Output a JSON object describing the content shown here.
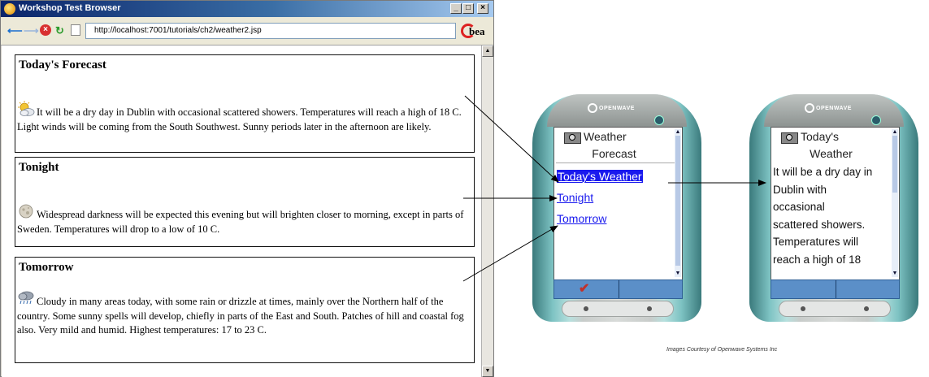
{
  "window": {
    "title": "Workshop Test Browser",
    "controls": {
      "minimize": "_",
      "maximize": "□",
      "close": "×"
    }
  },
  "toolbar": {
    "url": "http://localhost:7001/tutorials/ch2/weather2.jsp",
    "logo_text": "bea",
    "icons": [
      "back-arrow-icon",
      "forward-arrow-icon",
      "stop-icon",
      "refresh-icon",
      "page-icon"
    ]
  },
  "sections": [
    {
      "title": "Today's Forecast",
      "icon": "sun-cloud-icon",
      "text": "It will be a dry day in Dublin with occasional scattered showers. Temperatures will reach a high of 18 C. Light winds will be coming from the South Southwest. Sunny periods later in the afternoon are likely."
    },
    {
      "title": "Tonight",
      "icon": "moon-icon",
      "text": "Widespread darkness will be expected this evening but will brighten closer to morning, except in parts of Sweden. Temperatures will drop to a low of 10 C."
    },
    {
      "title": "Tomorrow",
      "icon": "rain-cloud-icon",
      "text": "Cloudy in many areas today, with some rain or drizzle at times, mainly over the Northern half of the country. Some sunny spells will develop, chiefly in parts of the East and South. Patches of hill and coastal fog also. Very mild and humid. Highest temperatures: 17 to 23 C."
    }
  ],
  "phone1": {
    "brand": "OPENWAVE",
    "title_line1": "Weather",
    "title_line2": "Forecast",
    "links": [
      "Today's Weather",
      "Tonight",
      "Tomorrow"
    ],
    "selected_index": 0,
    "softkey_left": "✔"
  },
  "phone2": {
    "brand": "OPENWAVE",
    "title_line1": "Today's",
    "title_line2": "Weather",
    "body_lines": [
      "It will be a dry day in",
      "Dublin with",
      "occasional",
      "scattered showers.",
      "Temperatures will",
      "reach a high of 18"
    ]
  },
  "credit": "Images Courtesy of Openwave Systems Inc",
  "colors": {
    "titlebar": "#0a246a",
    "link": "#1a1aee",
    "softbar": "#5b8fc8",
    "phone_accent": "#7ec3c3"
  }
}
